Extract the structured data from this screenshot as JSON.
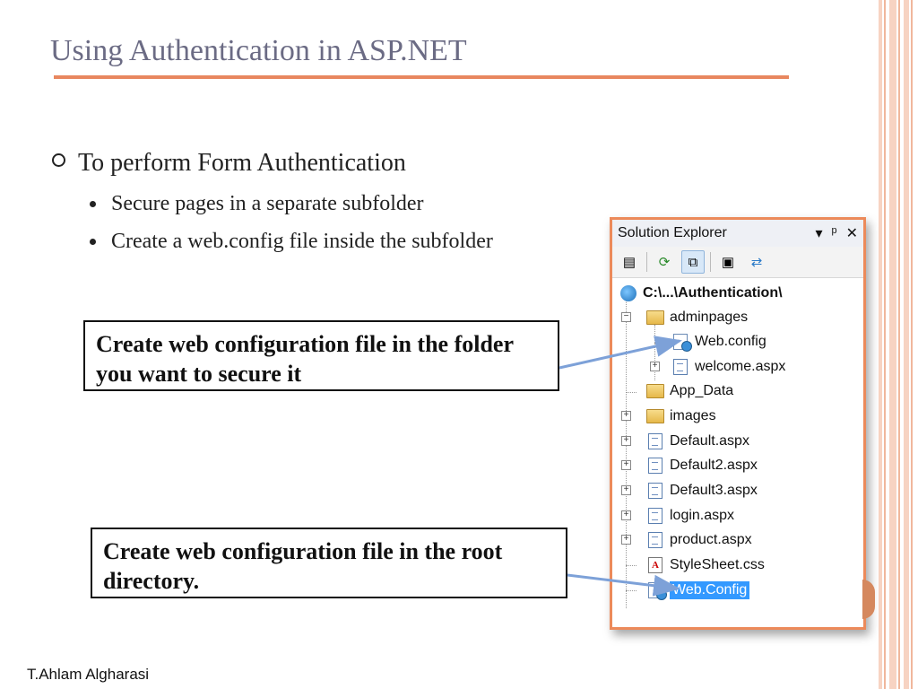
{
  "slide": {
    "title": "Using Authentication in ASP.NET",
    "bullet_main": "To perform Form Authentication",
    "sub_bullets": [
      "Secure pages in a separate subfolder",
      "Create a web.config file inside the subfolder"
    ],
    "callout_top": "Create web configuration file in the folder you want to secure it",
    "callout_bottom": "Create web configuration file in the root directory.",
    "footer": "T.Ahlam Algharasi"
  },
  "solution_explorer": {
    "title": "Solution Explorer",
    "buttons": {
      "dropdown": "▾",
      "pin": "ᵖ",
      "close": "✕"
    },
    "toolbar": [
      "properties-icon",
      "refresh-icon",
      "nest-related-files-icon",
      "view-designer-icon",
      "copy-website-icon"
    ],
    "tree": {
      "root": "C:\\...\\Authentication\\",
      "adminpages": "adminpages",
      "admin_webconfig": "Web.config",
      "welcome": "welcome.aspx",
      "app_data": "App_Data",
      "images": "images",
      "default": "Default.aspx",
      "default2": "Default2.aspx",
      "default3": "Default3.aspx",
      "login": "login.aspx",
      "product": "product.aspx",
      "stylesheet": "StyleSheet.css",
      "root_webconfig": "Web.Config"
    }
  },
  "colors": {
    "accent": "#e8875f",
    "border": "#ec8a5a",
    "selection": "#3399ff",
    "title": "#6b6b84"
  }
}
